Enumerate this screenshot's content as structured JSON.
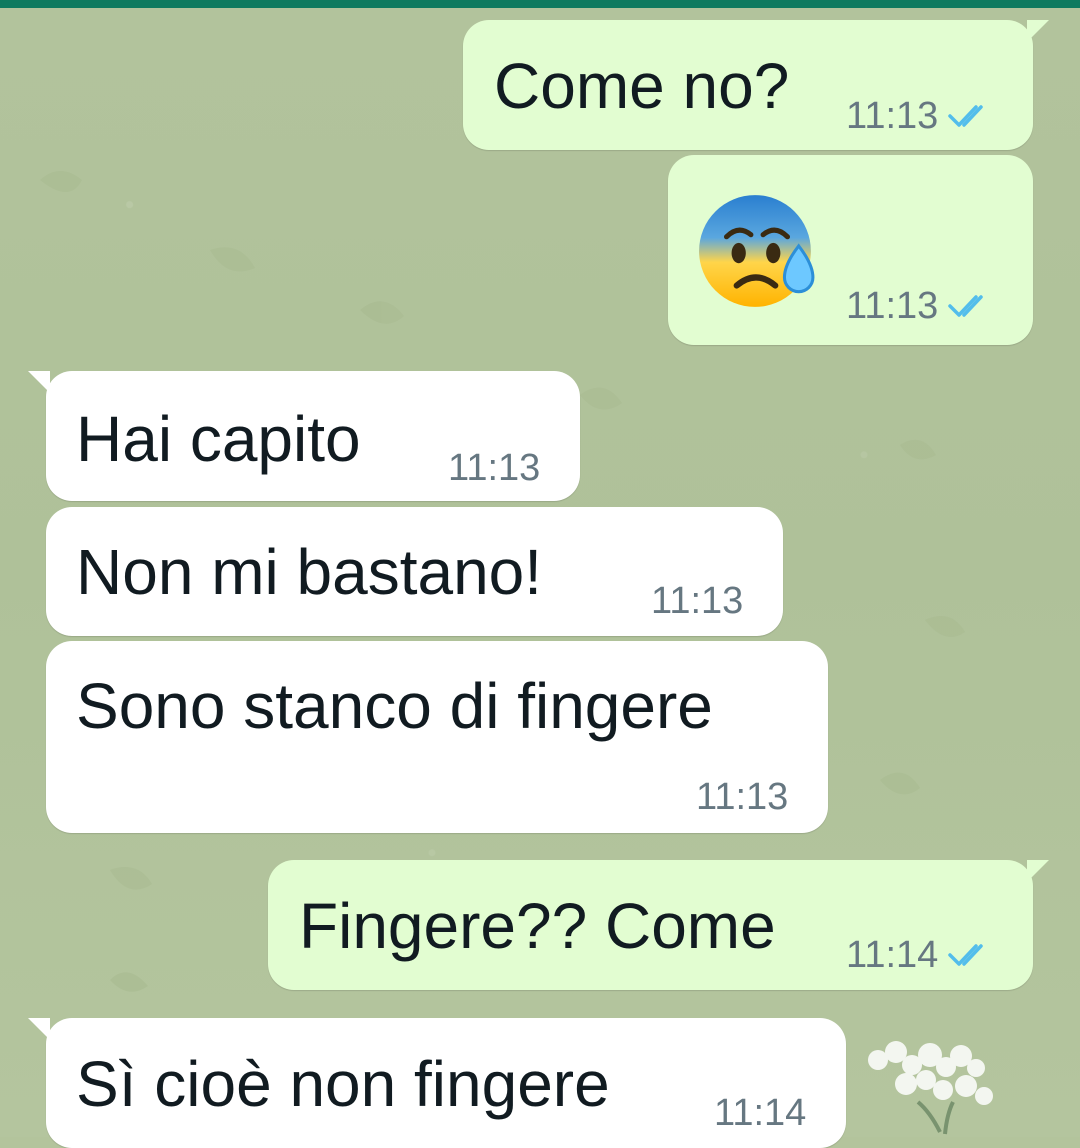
{
  "messages": [
    {
      "id": "m1",
      "direction": "out",
      "text": "Come no?",
      "time": "11:13",
      "status": "read"
    },
    {
      "id": "m2",
      "direction": "out",
      "emoji": "anxious-face-with-sweat",
      "time": "11:13",
      "status": "read"
    },
    {
      "id": "m3",
      "direction": "in",
      "text": "Hai capito",
      "time": "11:13"
    },
    {
      "id": "m4",
      "direction": "in",
      "text": "Non mi bastano!",
      "time": "11:13"
    },
    {
      "id": "m5",
      "direction": "in",
      "text": "Sono stanco di fingere",
      "time": "11:13"
    },
    {
      "id": "m6",
      "direction": "out",
      "text": "Fingere?? Come",
      "time": "11:14",
      "status": "read"
    },
    {
      "id": "m7",
      "direction": "in",
      "text": "Sì cioè non fingere",
      "time": "11:14"
    }
  ],
  "colors": {
    "header": "#0e7a5f",
    "outgoing_bubble": "#e2fdd1",
    "incoming_bubble": "#ffffff",
    "read_tick": "#53bdeb",
    "timestamp": "#667781",
    "text": "#111b21",
    "wallpaper": "#b3c49c"
  },
  "icons": {
    "read_receipt": "double-check-icon",
    "emoji": "anxious-face-with-sweat-emoji"
  }
}
